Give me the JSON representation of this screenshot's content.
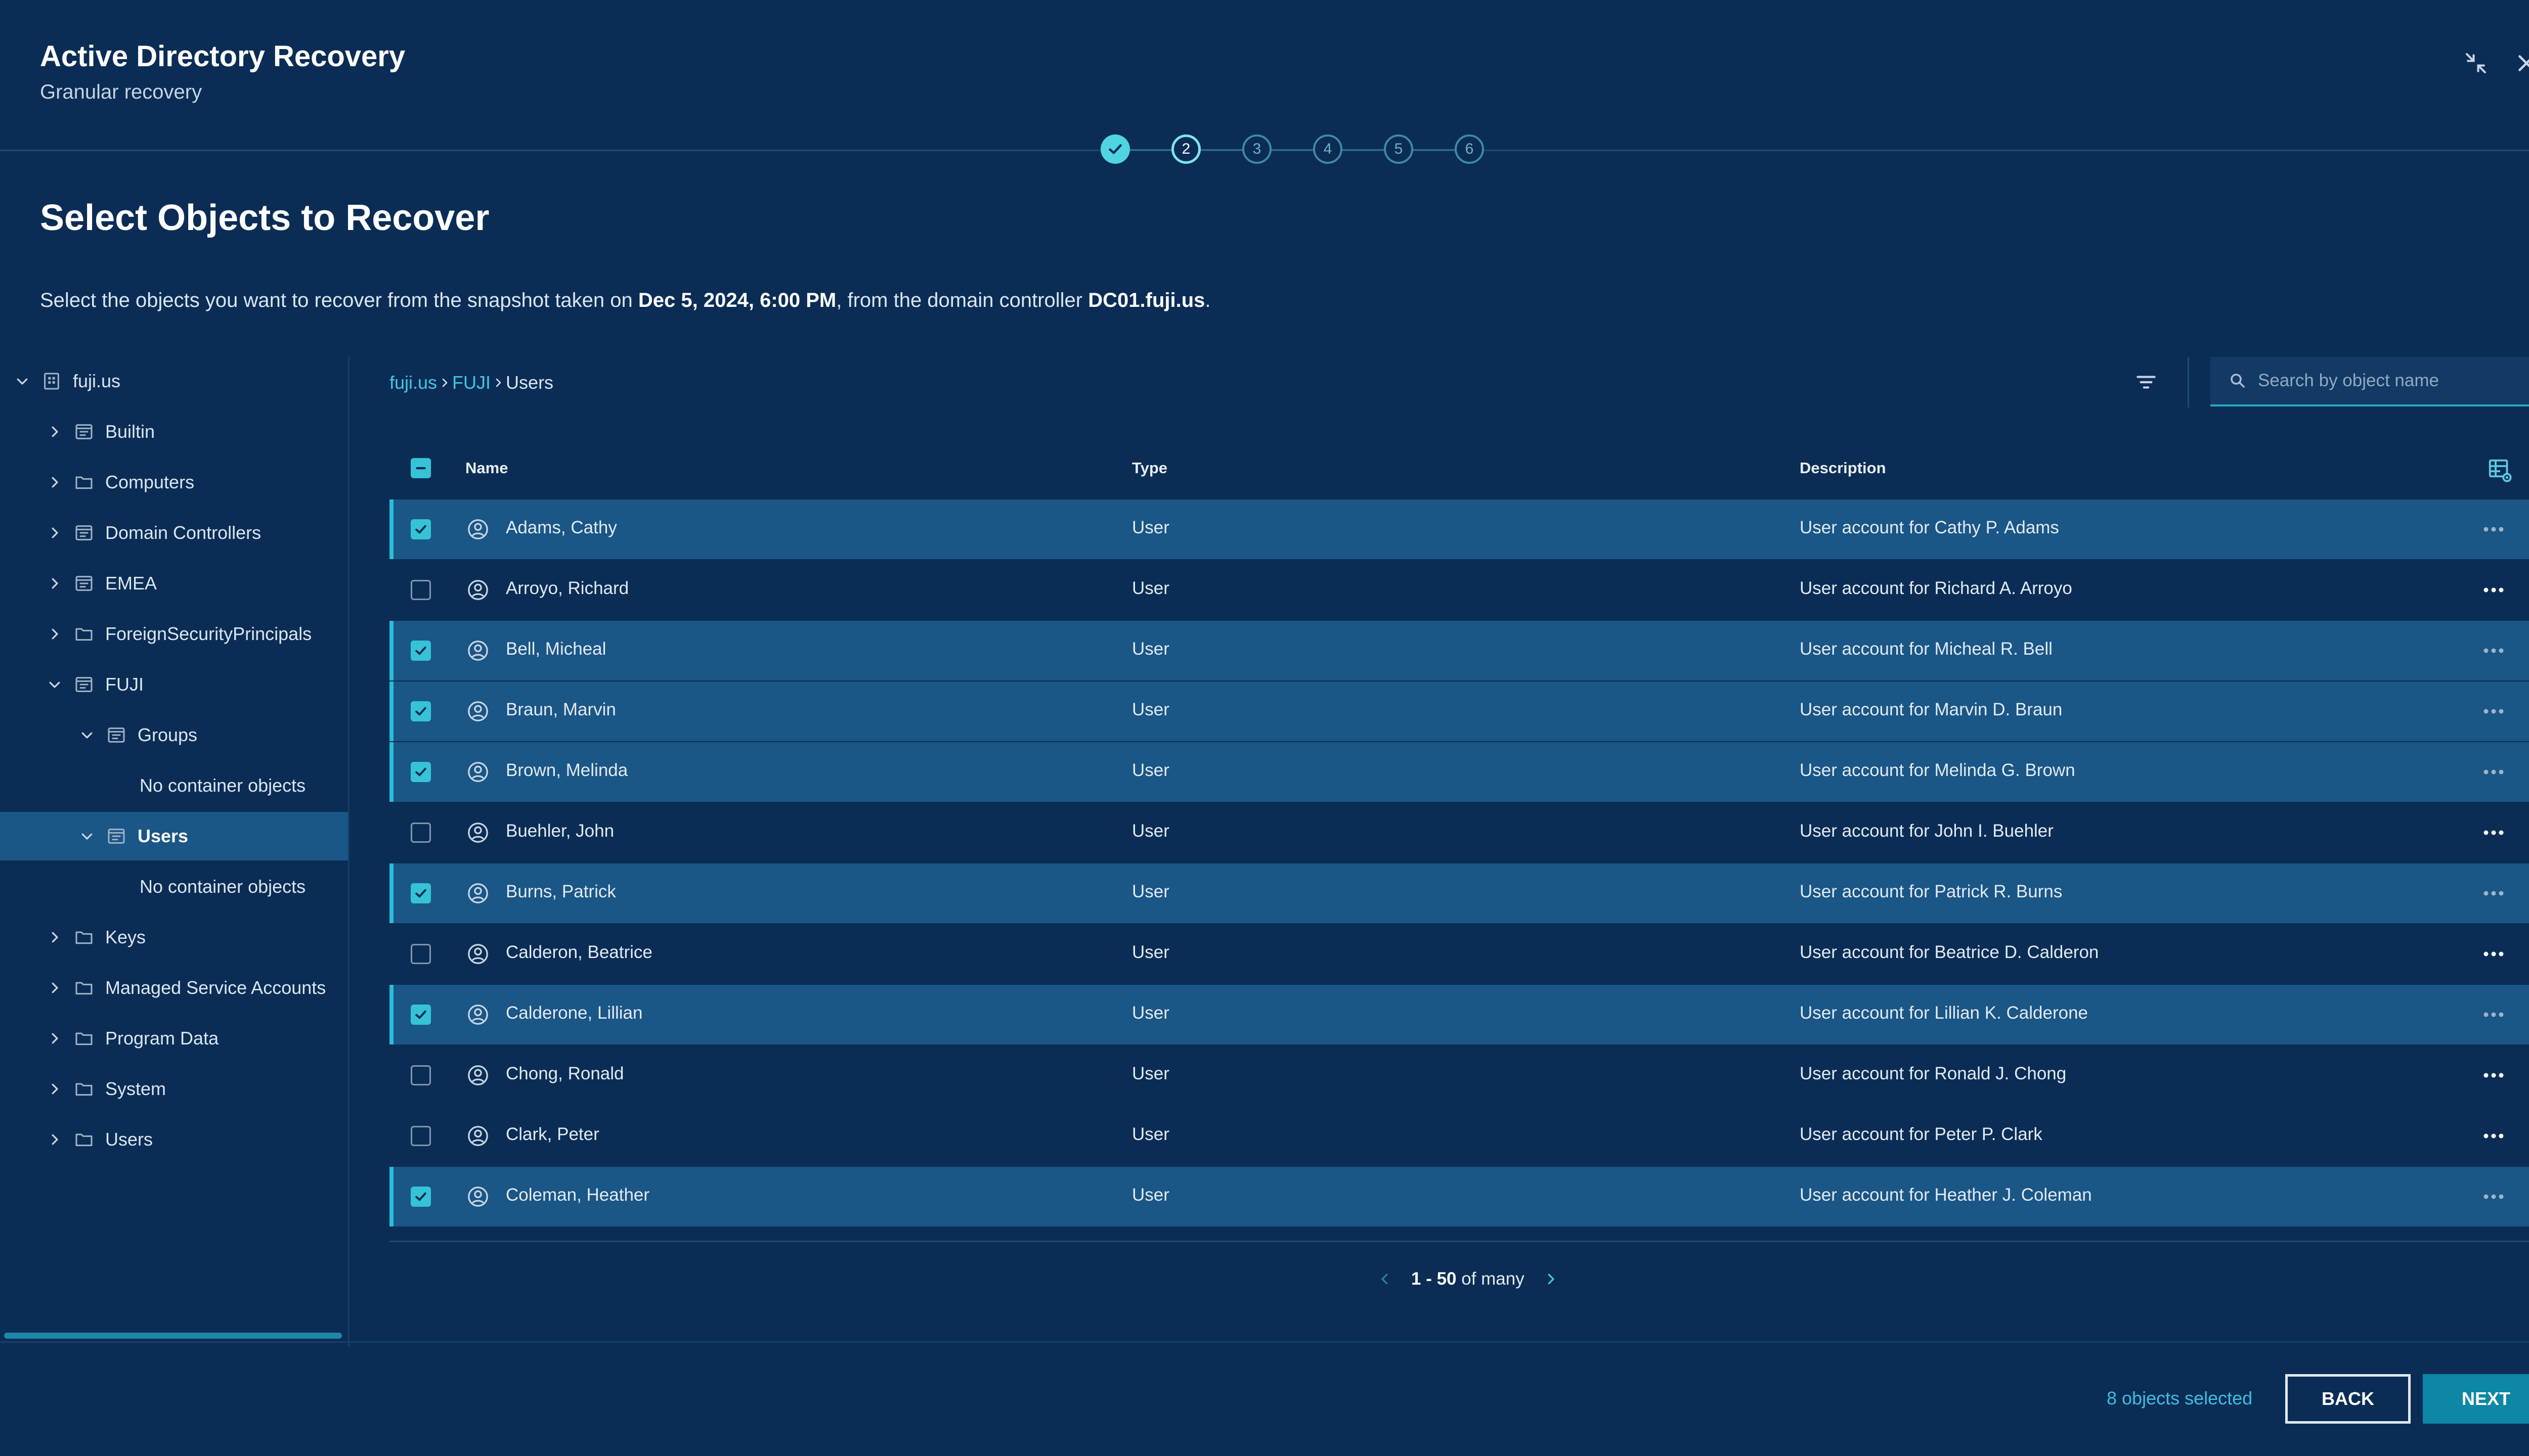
{
  "header": {
    "title": "Active Directory Recovery",
    "subtitle": "Granular recovery"
  },
  "stepper": {
    "steps": [
      "",
      "2",
      "3",
      "4",
      "5",
      "6"
    ],
    "current": 2
  },
  "page": {
    "title": "Select Objects to Recover",
    "intro_prefix": "Select the objects you want to recover from the snapshot taken on ",
    "snapshot_date": "Dec 5, 2024, 6:00 PM",
    "intro_middle": ", from the domain controller ",
    "domain_controller": "DC01.fuji.us",
    "intro_suffix": "."
  },
  "tree": [
    {
      "label": "fuji.us",
      "level": 0,
      "expand": "open",
      "icon": "domain-icon"
    },
    {
      "label": "Builtin",
      "level": 1,
      "expand": "closed",
      "icon": "container-icon"
    },
    {
      "label": "Computers",
      "level": 1,
      "expand": "closed",
      "icon": "folder-icon"
    },
    {
      "label": "Domain Controllers",
      "level": 1,
      "expand": "closed",
      "icon": "container-icon"
    },
    {
      "label": "EMEA",
      "level": 1,
      "expand": "closed",
      "icon": "container-icon"
    },
    {
      "label": "ForeignSecurityPrincipals",
      "level": 1,
      "expand": "closed",
      "icon": "folder-icon"
    },
    {
      "label": "FUJI",
      "level": 1,
      "expand": "open",
      "icon": "container-icon"
    },
    {
      "label": "Groups",
      "level": 2,
      "expand": "open",
      "icon": "container-icon"
    },
    {
      "label": "No container objects",
      "level": 3,
      "expand": "none",
      "icon": ""
    },
    {
      "label": "Users",
      "level": 2,
      "expand": "open",
      "icon": "container-icon",
      "selected": true
    },
    {
      "label": "No container objects",
      "level": 3,
      "expand": "none",
      "icon": ""
    },
    {
      "label": "Keys",
      "level": 1,
      "expand": "closed",
      "icon": "folder-icon"
    },
    {
      "label": "Managed Service Accounts",
      "level": 1,
      "expand": "closed",
      "icon": "folder-icon"
    },
    {
      "label": "Program Data",
      "level": 1,
      "expand": "closed",
      "icon": "folder-icon"
    },
    {
      "label": "System",
      "level": 1,
      "expand": "closed",
      "icon": "folder-icon"
    },
    {
      "label": "Users",
      "level": 1,
      "expand": "closed",
      "icon": "folder-icon"
    }
  ],
  "breadcrumb": {
    "items": [
      "fuji.us",
      "FUJI"
    ],
    "current": "Users"
  },
  "search": {
    "placeholder": "Search by object name"
  },
  "table": {
    "columns": {
      "name": "Name",
      "type": "Type",
      "description": "Description"
    },
    "rows": [
      {
        "name": "Adams, Cathy",
        "type": "User",
        "description": "User account for Cathy P. Adams",
        "selected": true
      },
      {
        "name": "Arroyo, Richard",
        "type": "User",
        "description": "User account for Richard A. Arroyo",
        "selected": false
      },
      {
        "name": "Bell, Micheal",
        "type": "User",
        "description": "User account for Micheal R. Bell",
        "selected": true
      },
      {
        "name": "Braun, Marvin",
        "type": "User",
        "description": "User account for Marvin D. Braun",
        "selected": true
      },
      {
        "name": "Brown, Melinda",
        "type": "User",
        "description": "User account for Melinda G. Brown",
        "selected": true
      },
      {
        "name": "Buehler, John",
        "type": "User",
        "description": "User account for John I. Buehler",
        "selected": false
      },
      {
        "name": "Burns, Patrick",
        "type": "User",
        "description": "User account for Patrick R. Burns",
        "selected": true
      },
      {
        "name": "Calderon, Beatrice",
        "type": "User",
        "description": "User account for Beatrice D. Calderon",
        "selected": false
      },
      {
        "name": "Calderone, Lillian",
        "type": "User",
        "description": "User account for Lillian K. Calderone",
        "selected": true
      },
      {
        "name": "Chong, Ronald",
        "type": "User",
        "description": "User account for Ronald J. Chong",
        "selected": false
      },
      {
        "name": "Clark, Peter",
        "type": "User",
        "description": "User account for Peter P. Clark",
        "selected": false
      },
      {
        "name": "Coleman, Heather",
        "type": "User",
        "description": "User account for Heather J. Coleman",
        "selected": true
      }
    ]
  },
  "pagination": {
    "range": "1 - 50",
    "suffix": "of many"
  },
  "footer": {
    "selected_text": "8 objects selected",
    "back_label": "BACK",
    "next_label": "NEXT"
  },
  "colors": {
    "background": "#0b2d55",
    "selected_row": "#1a5686",
    "accent": "#36c3d6",
    "link": "#44c6e4",
    "primary_button": "#0e86a6"
  }
}
